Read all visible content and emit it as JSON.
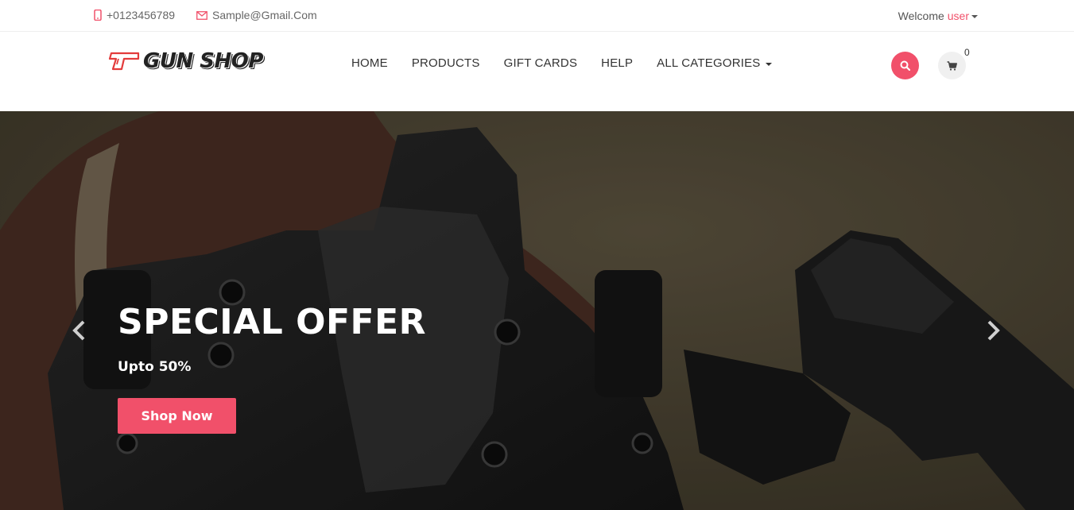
{
  "topbar": {
    "phone": "+0123456789",
    "email": "Sample@Gmail.Com",
    "welcome_text": "Welcome",
    "user_link": "user"
  },
  "logo": {
    "text": "GUN SHOP"
  },
  "nav": {
    "items": [
      {
        "label": "HOME"
      },
      {
        "label": "PRODUCTS"
      },
      {
        "label": "GIFT CARDS"
      },
      {
        "label": "HELP"
      },
      {
        "label": "ALL CATEGORIES"
      }
    ]
  },
  "cart": {
    "count": "0"
  },
  "hero": {
    "title": "SPECIAL OFFER",
    "subtitle": "Upto 50%",
    "button_label": "Shop Now"
  },
  "icons": {
    "phone": "phone-icon",
    "email": "envelope-icon",
    "search": "search-icon",
    "cart": "cart-icon",
    "prev": "chevron-left-icon",
    "next": "chevron-right-icon"
  },
  "colors": {
    "accent": "#f1506a",
    "hero_bg": "#4a4333",
    "text_dark": "#333333"
  }
}
